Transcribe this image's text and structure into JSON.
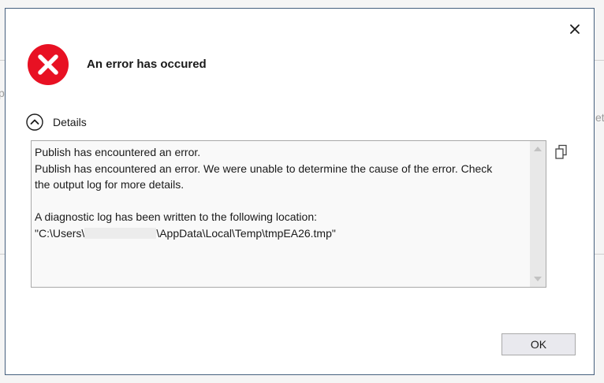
{
  "background": {
    "left_fragment": "p",
    "right_fragment": "ett"
  },
  "dialog": {
    "title": "An error has occured",
    "close_icon": "close-icon",
    "error_icon": "error-circle-icon",
    "error_color": "#e81123",
    "details": {
      "toggle_icon": "chevron-up-circle-icon",
      "label": "Details",
      "lines": {
        "line1": "Publish has encountered an error.",
        "line2": "Publish has encountered an error. We were unable to determine the cause of the error. Check",
        "line3": "the output log for more details.",
        "line5": "A diagnostic log has been written to the following location:",
        "line6_prefix": "\"C:\\Users\\",
        "line6_suffix": "\\AppData\\Local\\Temp\\tmpEA26.tmp\""
      }
    },
    "copy_icon": "copy-icon",
    "ok_label": "OK"
  }
}
